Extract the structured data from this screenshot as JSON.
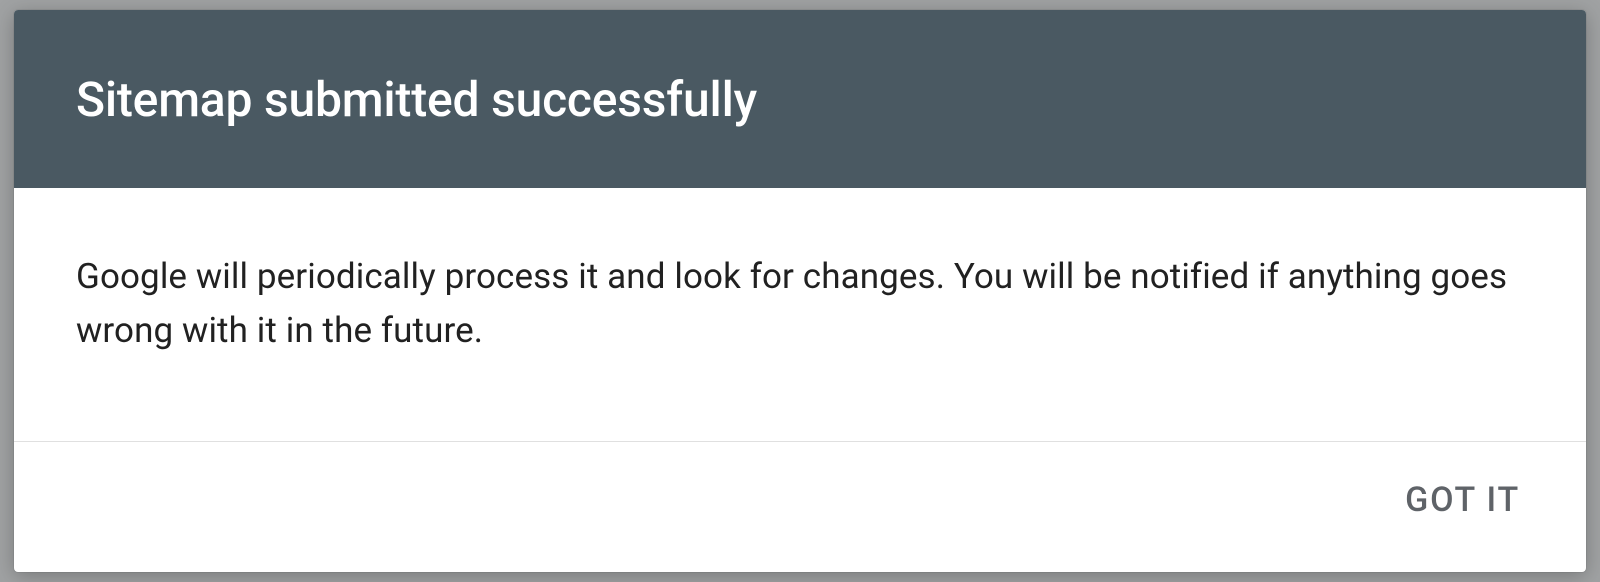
{
  "dialog": {
    "title": "Sitemap submitted successfully",
    "message": "Google will periodically process it and look for changes. You will be notified if anything goes wrong with it in the future.",
    "confirm_label": "GOT IT"
  }
}
